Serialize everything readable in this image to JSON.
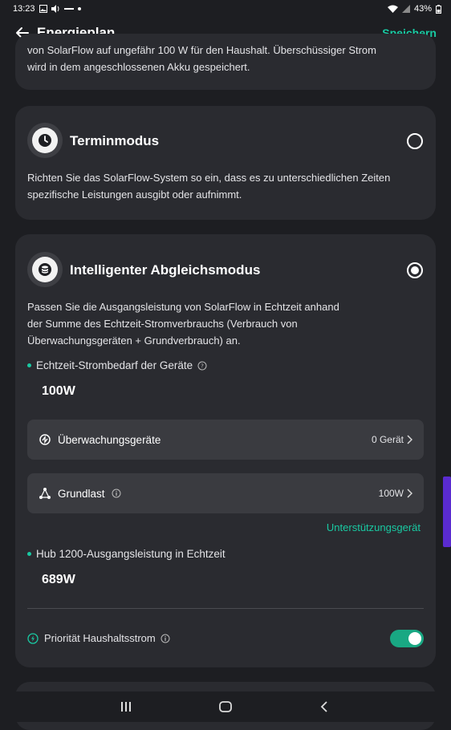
{
  "status_bar": {
    "time": "13:23",
    "battery": "43%",
    "icons": [
      "gallery-icon",
      "volume-icon",
      "voicemail-icon",
      "dot-icon",
      "wifi-icon",
      "signal-icon",
      "battery-icon"
    ]
  },
  "app_bar": {
    "title": "Energieplan",
    "save_label": "Speichern",
    "back_icon": "arrow-left-icon"
  },
  "cards": {
    "top_partial": {
      "description_line1": "von SolarFlow auf ungefähr 100 W für den Haushalt. Überschüssiger Strom",
      "description_line2": "wird in dem angeschlossenen Akku gespeichert."
    },
    "termin": {
      "icon": "clock-icon",
      "title": "Terminmodus",
      "selected": false,
      "description_line1": "Richten Sie das SolarFlow-System so ein, dass es zu unterschiedlichen Zeiten",
      "description_line2": "spezifische Leistungen ausgibt oder aufnimmt."
    },
    "smart": {
      "icon": "database-icon",
      "title": "Intelligenter Abgleichsmodus",
      "selected": true,
      "description_line1": "Passen Sie die Ausgangsleistung von SolarFlow in Echtzeit anhand",
      "description_line2": "der Summe des Echtzeit-Stromverbrauchs (Verbrauch von",
      "description_line3": "Überwachungsgeräten + Grundverbrauch) an.",
      "demand_label": "Echtzeit-Strombedarf der Geräte",
      "demand_value": "100W",
      "monitor_row": {
        "label": "Überwachungsgeräte",
        "value": "0 Gerät"
      },
      "base_row": {
        "label": "Grundlast",
        "value": "100W"
      },
      "support_link": "Unterstützungsgerät",
      "output_label": "Hub 1200-Ausgangsleistung in Echtzeit",
      "output_value": "689W",
      "priority_label": "Priorität Haushaltsstrom",
      "priority_on": true
    }
  },
  "colors": {
    "accent": "#19c9a2",
    "background": "#1d1e22",
    "card": "#2a2b30",
    "row": "#3a3b40",
    "scrollbar": "#5a2bd0"
  },
  "nav_bar": [
    "recents-icon",
    "home-icon",
    "back-icon"
  ]
}
